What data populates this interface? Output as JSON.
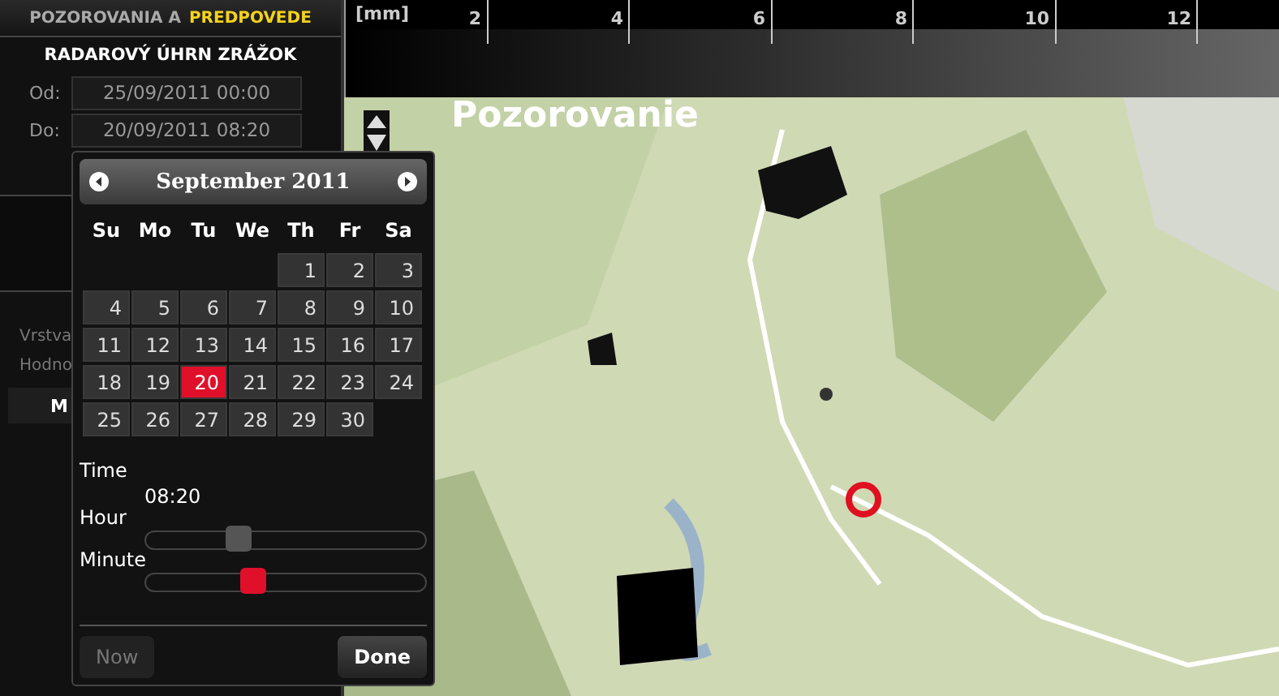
{
  "sidebar": {
    "header": {
      "text": "POZOROVANIA A",
      "highlight": "PREDPOVEDE"
    },
    "title": "RADAROVÝ ÚHRN ZRÁŽOK",
    "fields": [
      {
        "label": "Od:",
        "value": "25/09/2011 00:00"
      },
      {
        "label": "Do:",
        "value": "20/09/2011 08:20"
      }
    ],
    "rows": [
      {
        "label": "Vrstva"
      },
      {
        "label": "Hodno"
      }
    ],
    "button": "M"
  },
  "legend": {
    "unit": "[mm]",
    "ticks": [
      "2",
      "4",
      "6",
      "8",
      "10",
      "12"
    ]
  },
  "map": {
    "title": "Pozorovanie",
    "kind": "picture"
  },
  "datepicker": {
    "month": "September 2011",
    "weekdays": [
      "Su",
      "Mo",
      "Tu",
      "We",
      "Th",
      "Fr",
      "Sa"
    ],
    "weeks": [
      {
        "days": [
          {
            "label": "1",
            "selected": false
          },
          {
            "label": "2",
            "selected": false
          },
          {
            "label": "3",
            "selected": false
          }
        ]
      },
      {
        "days": [
          {
            "label": "4",
            "selected": false
          },
          {
            "label": "5",
            "selected": false
          },
          {
            "label": "6",
            "selected": false
          },
          {
            "label": "7",
            "selected": false
          },
          {
            "label": "8",
            "selected": false
          },
          {
            "label": "9",
            "selected": false
          },
          {
            "label": "10",
            "selected": false
          }
        ]
      },
      {
        "days": [
          {
            "label": "11",
            "selected": false
          },
          {
            "label": "12",
            "selected": false
          },
          {
            "label": "13",
            "selected": false
          },
          {
            "label": "14",
            "selected": false
          },
          {
            "label": "15",
            "selected": false
          },
          {
            "label": "16",
            "selected": false
          },
          {
            "label": "17",
            "selected": false
          }
        ]
      },
      {
        "days": [
          {
            "label": "18",
            "selected": false
          },
          {
            "label": "19",
            "selected": false
          },
          {
            "label": "20",
            "selected": true
          },
          {
            "label": "21",
            "selected": false
          },
          {
            "label": "22",
            "selected": false
          },
          {
            "label": "23",
            "selected": false
          },
          {
            "label": "24",
            "selected": false
          }
        ]
      },
      {
        "days": [
          {
            "label": "25",
            "selected": false
          },
          {
            "label": "26",
            "selected": false
          },
          {
            "label": "27",
            "selected": false
          },
          {
            "label": "28",
            "selected": false
          },
          {
            "label": "29",
            "selected": false
          },
          {
            "label": "30",
            "selected": false
          }
        ]
      }
    ],
    "time_label": "Time",
    "time": "08:20",
    "sliders": [
      {
        "label": "Hour",
        "level": 0.35,
        "active": false
      },
      {
        "label": "Minute",
        "level": 0.4,
        "active": true
      }
    ],
    "buttons": [
      {
        "label": "Now",
        "disabled": true
      },
      {
        "label": "Done",
        "disabled": false
      }
    ]
  }
}
